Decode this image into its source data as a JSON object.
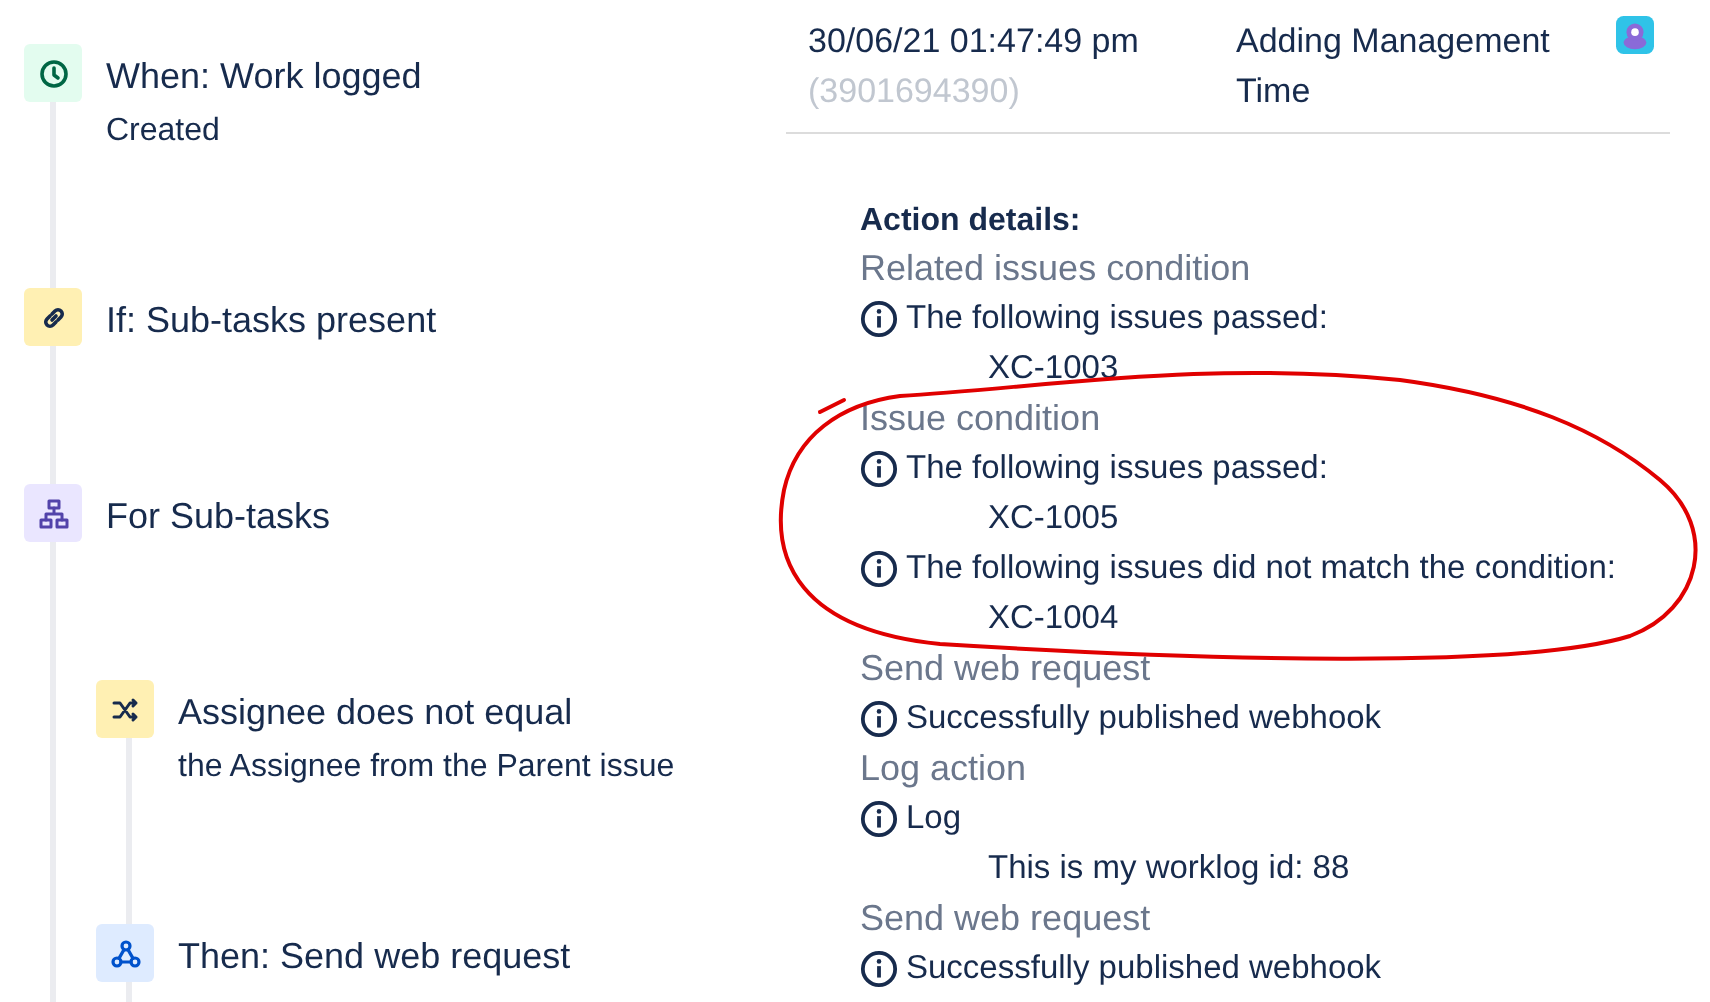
{
  "steps": [
    {
      "kind": "trigger",
      "title": "When: Work logged",
      "subtitle": "Created"
    },
    {
      "kind": "condition",
      "title": "If: Sub-tasks present"
    },
    {
      "kind": "branch",
      "title": "For Sub-tasks",
      "children": [
        {
          "kind": "compare",
          "title": "Assignee does not equal",
          "subtitle": "the Assignee from the Parent issue"
        },
        {
          "kind": "webhook",
          "title": "Then: Send web request"
        }
      ]
    }
  ],
  "log_entry": {
    "date": "30/06/21 01:47:49 pm",
    "id": "(3901694390)",
    "summary": "Adding Management Time"
  },
  "action_details": {
    "heading": "Action details:",
    "sections": [
      {
        "title": "Related issues condition",
        "messages": [
          {
            "text": "The following issues passed:",
            "items": [
              "XC-1003"
            ]
          }
        ]
      },
      {
        "title": "Issue condition",
        "messages": [
          {
            "text": "The following issues passed:",
            "items": [
              "XC-1005"
            ]
          },
          {
            "text": "The following issues did not match the condition:",
            "items": [
              "XC-1004"
            ]
          }
        ]
      },
      {
        "title": "Send web request",
        "messages": [
          {
            "text": "Successfully published webhook"
          }
        ]
      },
      {
        "title": "Log action",
        "messages": [
          {
            "text": "Log",
            "items": [
              "This is my worklog id: 88"
            ]
          }
        ]
      },
      {
        "title": "Send web request",
        "messages": [
          {
            "text": "Successfully published webhook"
          }
        ]
      }
    ]
  },
  "annotations": [
    {
      "kind": "freehand-loop"
    }
  ]
}
